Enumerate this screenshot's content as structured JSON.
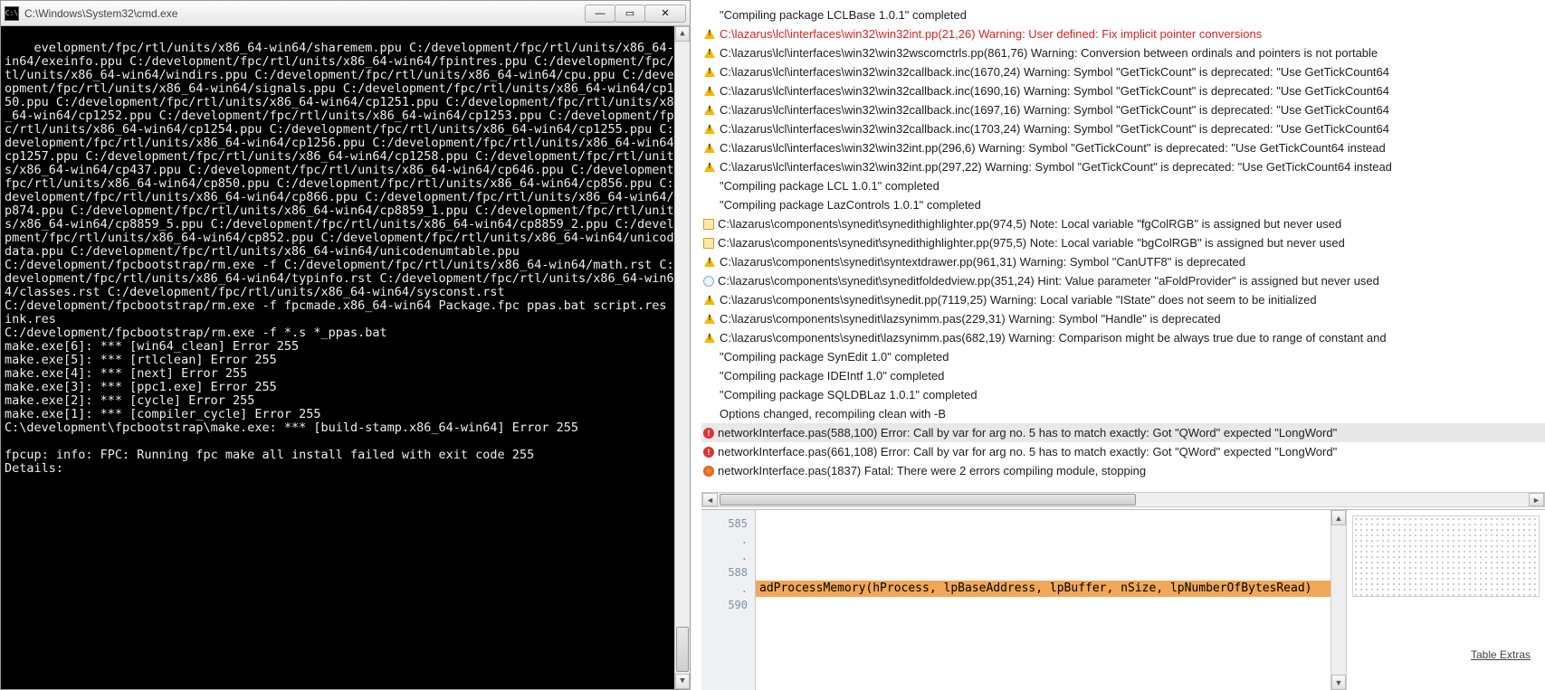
{
  "cmd": {
    "title": "C:\\Windows\\System32\\cmd.exe",
    "icon_label": "C:\\",
    "output": "evelopment/fpc/rtl/units/x86_64-win64/sharemem.ppu C:/development/fpc/rtl/units/x86_64-win64/exeinfo.ppu C:/development/fpc/rtl/units/x86_64-win64/fpintres.ppu C:/development/fpc/rtl/units/x86_64-win64/windirs.ppu C:/development/fpc/rtl/units/x86_64-win64/cpu.ppu C:/development/fpc/rtl/units/x86_64-win64/signals.ppu C:/development/fpc/rtl/units/x86_64-win64/cp1250.ppu C:/development/fpc/rtl/units/x86_64-win64/cp1251.ppu C:/development/fpc/rtl/units/x86_64-win64/cp1252.ppu C:/development/fpc/rtl/units/x86_64-win64/cp1253.ppu C:/development/fpc/rtl/units/x86_64-win64/cp1254.ppu C:/development/fpc/rtl/units/x86_64-win64/cp1255.ppu C:/development/fpc/rtl/units/x86_64-win64/cp1256.ppu C:/development/fpc/rtl/units/x86_64-win64/cp1257.ppu C:/development/fpc/rtl/units/x86_64-win64/cp1258.ppu C:/development/fpc/rtl/units/x86_64-win64/cp437.ppu C:/development/fpc/rtl/units/x86_64-win64/cp646.ppu C:/development/fpc/rtl/units/x86_64-win64/cp850.ppu C:/development/fpc/rtl/units/x86_64-win64/cp856.ppu C:/development/fpc/rtl/units/x86_64-win64/cp866.ppu C:/development/fpc/rtl/units/x86_64-win64/cp874.ppu C:/development/fpc/rtl/units/x86_64-win64/cp8859_1.ppu C:/development/fpc/rtl/units/x86_64-win64/cp8859_5.ppu C:/development/fpc/rtl/units/x86_64-win64/cp8859_2.ppu C:/development/fpc/rtl/units/x86_64-win64/cp852.ppu C:/development/fpc/rtl/units/x86_64-win64/unicodedata.ppu C:/development/fpc/rtl/units/x86_64-win64/unicodenumtable.ppu\nC:/development/fpcbootstrap/rm.exe -f C:/development/fpc/rtl/units/x86_64-win64/math.rst C:/development/fpc/rtl/units/x86_64-win64/typinfo.rst C:/development/fpc/rtl/units/x86_64-win64/classes.rst C:/development/fpc/rtl/units/x86_64-win64/sysconst.rst\nC:/development/fpcbootstrap/rm.exe -f fpcmade.x86_64-win64 Package.fpc ppas.bat script.res link.res\nC:/development/fpcbootstrap/rm.exe -f *.s *_ppas.bat\nmake.exe[6]: *** [win64_clean] Error 255\nmake.exe[5]: *** [rtlclean] Error 255\nmake.exe[4]: *** [next] Error 255\nmake.exe[3]: *** [ppc1.exe] Error 255\nmake.exe[2]: *** [cycle] Error 255\nmake.exe[1]: *** [compiler_cycle] Error 255\nC:\\development\\fpcbootstrap\\make.exe: *** [build-stamp.x86_64-win64] Error 255\n\nfpcup: info: FPC: Running fpc make all install failed with exit code 255\nDetails:"
  },
  "messages": [
    {
      "icon": "",
      "text": "\"Compiling package LCLBase 1.0.1\" completed"
    },
    {
      "icon": "warn",
      "highlighted": true,
      "text": "C:\\lazarus\\lcl\\interfaces\\win32\\win32int.pp(21,26) Warning: User defined: Fix implicit pointer conversions"
    },
    {
      "icon": "warn",
      "text": "C:\\lazarus\\lcl\\interfaces\\win32\\win32wscomctrls.pp(861,76) Warning: Conversion between ordinals and pointers is not portable"
    },
    {
      "icon": "warn",
      "text": "C:\\lazarus\\lcl\\interfaces\\win32\\win32callback.inc(1670,24) Warning: Symbol \"GetTickCount\" is deprecated: \"Use GetTickCount64"
    },
    {
      "icon": "warn",
      "text": "C:\\lazarus\\lcl\\interfaces\\win32\\win32callback.inc(1690,16) Warning: Symbol \"GetTickCount\" is deprecated: \"Use GetTickCount64"
    },
    {
      "icon": "warn",
      "text": "C:\\lazarus\\lcl\\interfaces\\win32\\win32callback.inc(1697,16) Warning: Symbol \"GetTickCount\" is deprecated: \"Use GetTickCount64"
    },
    {
      "icon": "warn",
      "text": "C:\\lazarus\\lcl\\interfaces\\win32\\win32callback.inc(1703,24) Warning: Symbol \"GetTickCount\" is deprecated: \"Use GetTickCount64"
    },
    {
      "icon": "warn",
      "text": "C:\\lazarus\\lcl\\interfaces\\win32\\win32int.pp(296,6) Warning: Symbol \"GetTickCount\" is deprecated: \"Use GetTickCount64 instead"
    },
    {
      "icon": "warn",
      "text": "C:\\lazarus\\lcl\\interfaces\\win32\\win32int.pp(297,22) Warning: Symbol \"GetTickCount\" is deprecated: \"Use GetTickCount64 instead"
    },
    {
      "icon": "",
      "text": "\"Compiling package LCL 1.0.1\" completed"
    },
    {
      "icon": "",
      "text": "\"Compiling package LazControls 1.0.1\" completed"
    },
    {
      "icon": "note",
      "text": "C:\\lazarus\\components\\synedit\\synedithighlighter.pp(974,5) Note: Local variable \"fgColRGB\" is assigned but never used"
    },
    {
      "icon": "note",
      "text": "C:\\lazarus\\components\\synedit\\synedithighlighter.pp(975,5) Note: Local variable \"bgColRGB\" is assigned but never used"
    },
    {
      "icon": "warn",
      "text": "C:\\lazarus\\components\\synedit\\syntextdrawer.pp(961,31) Warning: Symbol \"CanUTF8\" is deprecated"
    },
    {
      "icon": "hint",
      "text": "C:\\lazarus\\components\\synedit\\syneditfoldedview.pp(351,24) Hint: Value parameter \"aFoldProvider\" is assigned but never used"
    },
    {
      "icon": "warn",
      "text": "C:\\lazarus\\components\\synedit\\synedit.pp(7119,25) Warning: Local variable \"IState\" does not seem to be initialized"
    },
    {
      "icon": "warn",
      "text": "C:\\lazarus\\components\\synedit\\lazsynimm.pas(229,31) Warning: Symbol \"Handle\" is deprecated"
    },
    {
      "icon": "warn",
      "text": "C:\\lazarus\\components\\synedit\\lazsynimm.pas(682,19) Warning: Comparison might be always true due to range of constant and"
    },
    {
      "icon": "",
      "text": "\"Compiling package SynEdit 1.0\" completed"
    },
    {
      "icon": "",
      "text": "\"Compiling package IDEIntf 1.0\" completed"
    },
    {
      "icon": "",
      "text": "\"Compiling package SQLDBLaz 1.0.1\" completed"
    },
    {
      "icon": "",
      "text": "Options changed, recompiling clean with -B"
    },
    {
      "icon": "error",
      "selected": true,
      "text": "networkInterface.pas(588,100) Error: Call by var for arg no. 5 has to match exactly: Got \"QWord\" expected \"LongWord\""
    },
    {
      "icon": "error",
      "text": "networkInterface.pas(661,108) Error: Call by var for arg no. 5 has to match exactly: Got \"QWord\" expected \"LongWord\""
    },
    {
      "icon": "fatal",
      "text": "networkInterface.pas(1837) Fatal: There were 2 errors compiling module, stopping"
    }
  ],
  "editor": {
    "gutter": [
      "",
      "585",
      ".",
      ".",
      "588",
      ".",
      "590",
      ""
    ],
    "lines": [
      "",
      "",
      "",
      "",
      "adProcessMemory(hProcess, lpBaseAddress, lpBuffer, nSize, lpNumberOfBytesRead)",
      "",
      "",
      ""
    ],
    "highlight_index": 4,
    "side_label": "Table Extras"
  }
}
